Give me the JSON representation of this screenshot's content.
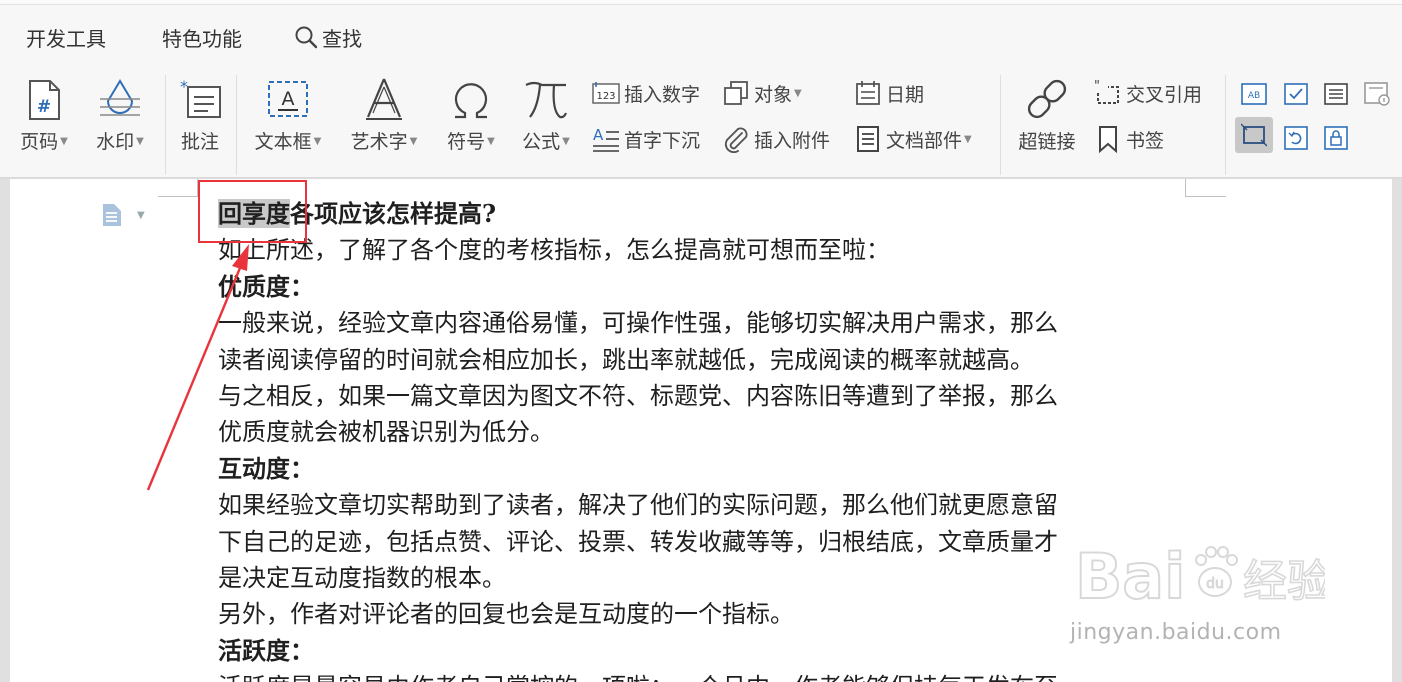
{
  "tabs": {
    "developer_tools": "开发工具",
    "special_features": "特色功能",
    "find": "查找"
  },
  "toolbar": {
    "page_number": "页码",
    "watermark": "水印",
    "comment": "批注",
    "text_box": "文本框",
    "word_art": "艺术字",
    "symbol": "符号",
    "formula": "公式",
    "insert_number": "插入数字",
    "object": "对象",
    "date": "日期",
    "drop_cap": "首字下沉",
    "insert_attachment": "插入附件",
    "doc_parts": "文档部件",
    "hyperlink": "超链接",
    "cross_reference": "交叉引用",
    "bookmark": "书签"
  },
  "document": {
    "heading_highlight": "回享度",
    "heading_rest": "各项应该怎样提高?",
    "lines": [
      {
        "text": "如上所述，了解了各个度的考核指标，怎么提高就可想而至啦：",
        "bold": false
      },
      {
        "text": "优质度：",
        "bold": true
      },
      {
        "text": "一般来说，经验文章内容通俗易懂，可操作性强，能够切实解决用户需求，那么",
        "bold": false
      },
      {
        "text": "读者阅读停留的时间就会相应加长，跳出率就越低，完成阅读的概率就越高。",
        "bold": false
      },
      {
        "text": "与之相反，如果一篇文章因为图文不符、标题党、内容陈旧等遭到了举报，那么",
        "bold": false
      },
      {
        "text": "优质度就会被机器识别为低分。",
        "bold": false
      },
      {
        "text": "互动度：",
        "bold": true
      },
      {
        "text": "如果经验文章切实帮助到了读者，解决了他们的实际问题，那么他们就更愿意留",
        "bold": false
      },
      {
        "text": "下自己的足迹，包括点赞、评论、投票、转发收藏等等，归根结底，文章质量才",
        "bold": false
      },
      {
        "text": "是决定互动度指数的根本。",
        "bold": false
      },
      {
        "text": "另外，作者对评论者的回复也会是互动度的一个指标。",
        "bold": false
      },
      {
        "text": "活跃度：",
        "bold": true
      },
      {
        "text": "活跃度是最容易由作者自己掌控的一项啦：一个月中，作者能够保持每天发布至",
        "bold": false
      }
    ]
  },
  "watermark": {
    "brand": "Bai  经验",
    "url": "jingyan.baidu.com"
  },
  "colors": {
    "annotation_red": "#e8343a",
    "toolbar_blue": "#2f6fb8",
    "highlight_gray": "#c9c9c9"
  }
}
